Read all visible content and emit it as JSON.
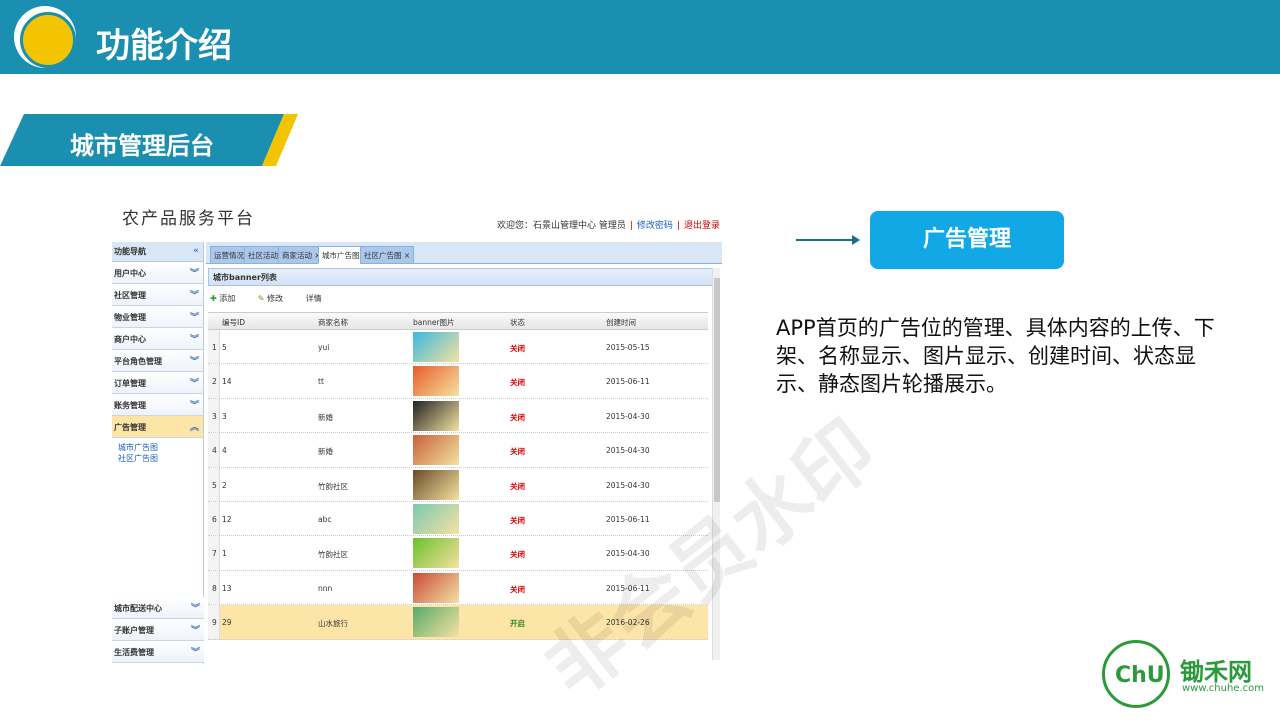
{
  "slide": {
    "title": "功能介绍",
    "section_title": "城市管理后台"
  },
  "app": {
    "brand": "农产品服务平台",
    "welcome_text": "欢迎您：石景山管理中心 管理员",
    "change_password": "修改密码",
    "logout": "退出登录",
    "sidebar_header": "功能导航",
    "sidebar_items": [
      "用户中心",
      "社区管理",
      "物业管理",
      "商户中心",
      "平台角色管理",
      "订单管理",
      "账务管理",
      "广告管理"
    ],
    "sidebar_subitems": [
      "城市广告图",
      "社区广告图"
    ],
    "sidebar_bottom": [
      "城市配送中心",
      "子账户管理",
      "生活费管理"
    ],
    "tabs": [
      "运营情况",
      "社区活动",
      "商家活动",
      "城市广告图",
      "社区广告图"
    ],
    "panel_title": "城市banner列表",
    "toolbar": {
      "add": "添加",
      "edit": "修改",
      "detail": "详情"
    },
    "columns": [
      "编号ID",
      "商家名称",
      "banner图片",
      "状态",
      "创建时间"
    ],
    "rows": [
      {
        "n": "1",
        "id": "5",
        "name": "yui",
        "status": "关闭",
        "date": "2015-05-15",
        "img": "#3bb8e0"
      },
      {
        "n": "2",
        "id": "14",
        "name": "tt",
        "status": "关闭",
        "date": "2015-06-11",
        "img": "#e85d2a"
      },
      {
        "n": "3",
        "id": "3",
        "name": "新婚",
        "status": "关闭",
        "date": "2015-04-30",
        "img": "#222222"
      },
      {
        "n": "4",
        "id": "4",
        "name": "新婚",
        "status": "关闭",
        "date": "2015-04-30",
        "img": "#c8623a"
      },
      {
        "n": "5",
        "id": "2",
        "name": "竹韵社区",
        "status": "关闭",
        "date": "2015-04-30",
        "img": "#6a4a2a"
      },
      {
        "n": "6",
        "id": "12",
        "name": "abc",
        "status": "关闭",
        "date": "2015-06-11",
        "img": "#7cc8b0"
      },
      {
        "n": "7",
        "id": "1",
        "name": "竹韵社区",
        "status": "关闭",
        "date": "2015-04-30",
        "img": "#6ac02a"
      },
      {
        "n": "8",
        "id": "13",
        "name": "nnn",
        "status": "关闭",
        "date": "2015-06-11",
        "img": "#c84a3a"
      },
      {
        "n": "9",
        "id": "29",
        "name": "山水旅行",
        "status": "开启",
        "date": "2016-02-26",
        "img": "#5aaa6a"
      }
    ]
  },
  "watermark": "非会员水印",
  "feature": {
    "button": "广告管理",
    "description": "APP首页的广告位的管理、具体内容的上传、下架、名称显示、图片显示、创建时间、状态显示、静态图片轮播展示。"
  },
  "footer": {
    "logo_text": "ChuHe",
    "name": "锄禾网",
    "url": "www.chuhe.com"
  }
}
